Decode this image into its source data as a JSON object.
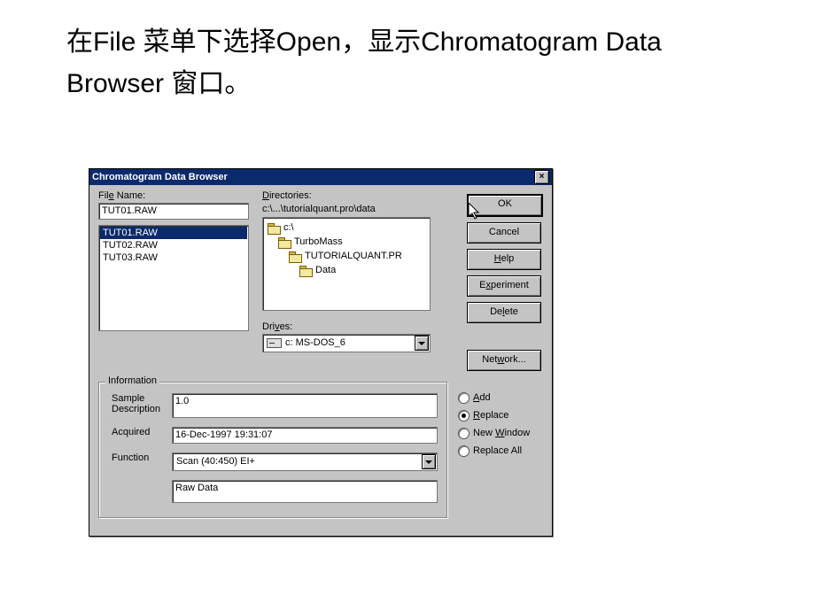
{
  "slide": {
    "title": "在File 菜单下选择Open，显示Chromatogram Data Browser 窗口。"
  },
  "dialog": {
    "title": "Chromatogram Data Browser",
    "close_x": "×",
    "filename_label": "File Name:",
    "filename_value": "TUT01.RAW",
    "file_list": [
      "TUT01.RAW",
      "TUT02.RAW",
      "TUT03.RAW"
    ],
    "file_selected_index": 0,
    "directories_label": "Directories:",
    "path": "c:\\...\\tutorialquant.pro\\data",
    "tree": {
      "root": "c:\\",
      "nodes": [
        "TurboMass",
        "TUTORIALQUANT.PR",
        "Data"
      ]
    },
    "drives_label": "Drives:",
    "drive_value": "c: MS-DOS_6",
    "buttons": {
      "ok": "OK",
      "cancel": "Cancel",
      "help": "Help",
      "experiment": "Experiment",
      "delete": "Delete",
      "network": "Network..."
    },
    "radios": {
      "add": "Add",
      "replace": "Replace",
      "new_window": "New Window",
      "replace_all": "Replace All"
    },
    "info": {
      "legend": "Information",
      "sample_desc_label": "Sample Description",
      "sample_desc_value": "1.0",
      "acquired_label": "Acquired",
      "acquired_value": "16-Dec-1997  19:31:07",
      "function_label": "Function",
      "function_value": "Scan (40:450) EI+",
      "raw_data": "Raw Data"
    }
  }
}
